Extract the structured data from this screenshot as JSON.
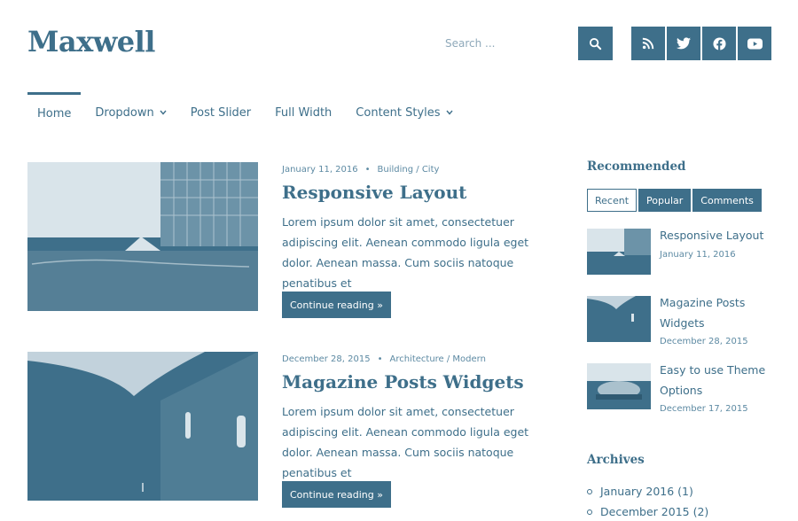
{
  "site": {
    "title": "Maxwell"
  },
  "search": {
    "placeholder": "Search ..."
  },
  "header_icons": [
    "search-icon",
    "rss-icon",
    "twitter-icon",
    "facebook-icon",
    "youtube-icon"
  ],
  "nav": {
    "items": [
      {
        "label": "Home",
        "active": true
      },
      {
        "label": "Dropdown",
        "has_submenu": true
      },
      {
        "label": "Post Slider"
      },
      {
        "label": "Full Width"
      },
      {
        "label": "Content Styles",
        "has_submenu": true
      }
    ]
  },
  "posts": [
    {
      "date": "January 11, 2016",
      "categories": "Building / City",
      "title": "Responsive Layout",
      "excerpt": "Lorem ipsum dolor sit amet, consectetuer adipiscing elit. Aenean commodo ligula eget dolor. Aenean massa. Cum sociis natoque penatibus et",
      "read_more": "Continue reading »"
    },
    {
      "date": "December 28, 2015",
      "categories": "Architecture / Modern",
      "title": "Magazine Posts Widgets",
      "excerpt": "Lorem ipsum dolor sit amet, consectetuer adipiscing elit. Aenean commodo ligula eget dolor. Aenean massa. Cum sociis natoque penatibus et",
      "read_more": "Continue reading »"
    }
  ],
  "sidebar": {
    "recommended_heading": "Recommended",
    "tabs": [
      {
        "label": "Recent",
        "active": true
      },
      {
        "label": "Popular"
      },
      {
        "label": "Comments"
      }
    ],
    "recent_posts": [
      {
        "title": "Responsive Layout",
        "date": "January 11, 2016"
      },
      {
        "title": "Magazine Posts Widgets",
        "date": "December 28, 2015"
      },
      {
        "title": "Easy to use Theme Options",
        "date": "December 17, 2015"
      }
    ],
    "archives_heading": "Archives",
    "archives": [
      {
        "label": "January 2016 (1)"
      },
      {
        "label": "December 2015 (2)"
      }
    ]
  },
  "colors": {
    "accent": "#3e6f8a",
    "background": "#ffffff",
    "meta": "#5d8aa3"
  }
}
